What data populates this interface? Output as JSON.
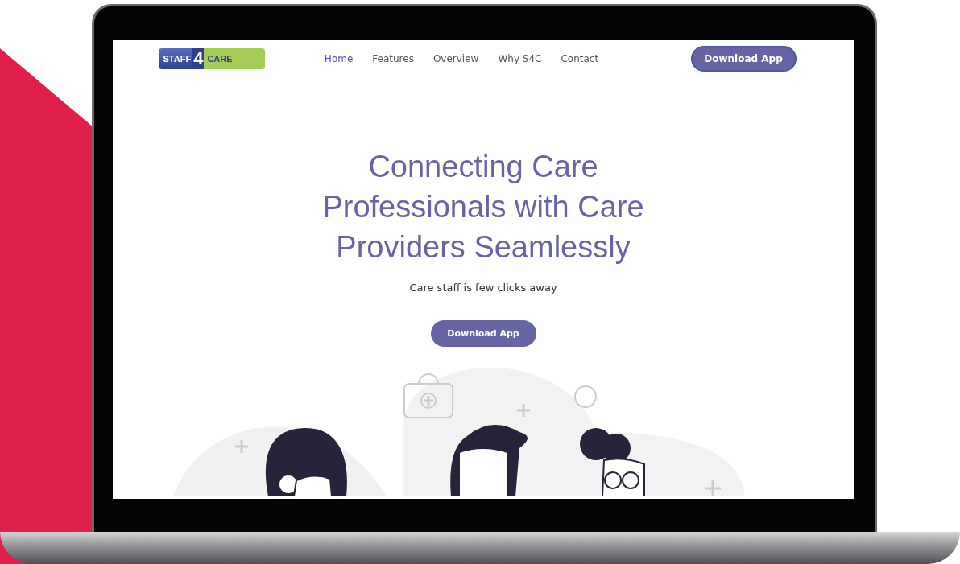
{
  "logo": {
    "left": "STAFF",
    "number": "4",
    "right": "CARE"
  },
  "nav": {
    "links": [
      {
        "label": "Home",
        "selected": true
      },
      {
        "label": "Features",
        "selected": false
      },
      {
        "label": "Overview",
        "selected": false
      },
      {
        "label": "Why S4C",
        "selected": false
      },
      {
        "label": "Contact",
        "selected": false
      }
    ],
    "button": "Download App"
  },
  "hero": {
    "title": "Connecting Care Professionals with Care Providers Seamlessly",
    "subtitle": "Care staff is few clicks away",
    "button": "Download App"
  }
}
